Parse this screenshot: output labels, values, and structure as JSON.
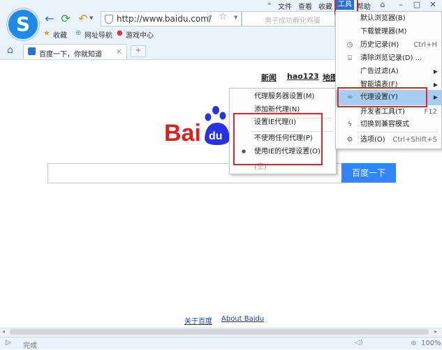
{
  "toolbar": {
    "address_url": "http://www.baidu.com/",
    "search_placeholder": "男子成功孵化鸡蛋",
    "menus": [
      "文件",
      "查看",
      "收藏",
      "工具",
      "帮助"
    ]
  },
  "favorites_bar": {
    "items": [
      "收藏",
      "网址导航",
      "游戏中心"
    ]
  },
  "tab": {
    "title": "百度一下，你就知道",
    "close": "×",
    "new": "+"
  },
  "page": {
    "topnav": [
      "新闻",
      "hao123",
      "地图"
    ],
    "search_button": "百度一下",
    "footer_links": [
      "关于百度",
      "About Baidu"
    ]
  },
  "tools_menu": {
    "items": [
      {
        "label": "默认浏览器(B)",
        "shortcut": ""
      },
      {
        "label": "下载管理器(M)",
        "shortcut": ""
      },
      {
        "label": "历史记录(H)",
        "shortcut": "Ctrl+H"
      },
      {
        "label": "清除浏览记录(D) ...",
        "shortcut": ""
      },
      {
        "label": "广告过滤(A)",
        "shortcut": ""
      },
      {
        "label": "智能填表(F)",
        "shortcut": ""
      },
      {
        "label": "代理设置(Y)",
        "shortcut": ""
      },
      {
        "label": "开发者工具(T)",
        "shortcut": "F12"
      },
      {
        "label": "切换到兼容模式",
        "shortcut": ""
      },
      {
        "label": "选项(O)",
        "shortcut": "Ctrl+Shift+S"
      }
    ]
  },
  "proxy_submenu": {
    "items": [
      {
        "label": "代理服务器设置(M)"
      },
      {
        "label": "添加新代理(N)"
      },
      {
        "label": "设置IE代理(I)"
      },
      {
        "label": "不使用任何代理(P)"
      },
      {
        "label": "使用IE的代理设置(O)"
      },
      {
        "label": "(空)"
      }
    ]
  },
  "status": {
    "text": "完成",
    "zoom": "100%"
  },
  "colors": {
    "accent": "#2a6fd1",
    "highlight": "#a8cdf3",
    "annotation": "#d9262f",
    "baidu_blue": "#3385ff"
  }
}
